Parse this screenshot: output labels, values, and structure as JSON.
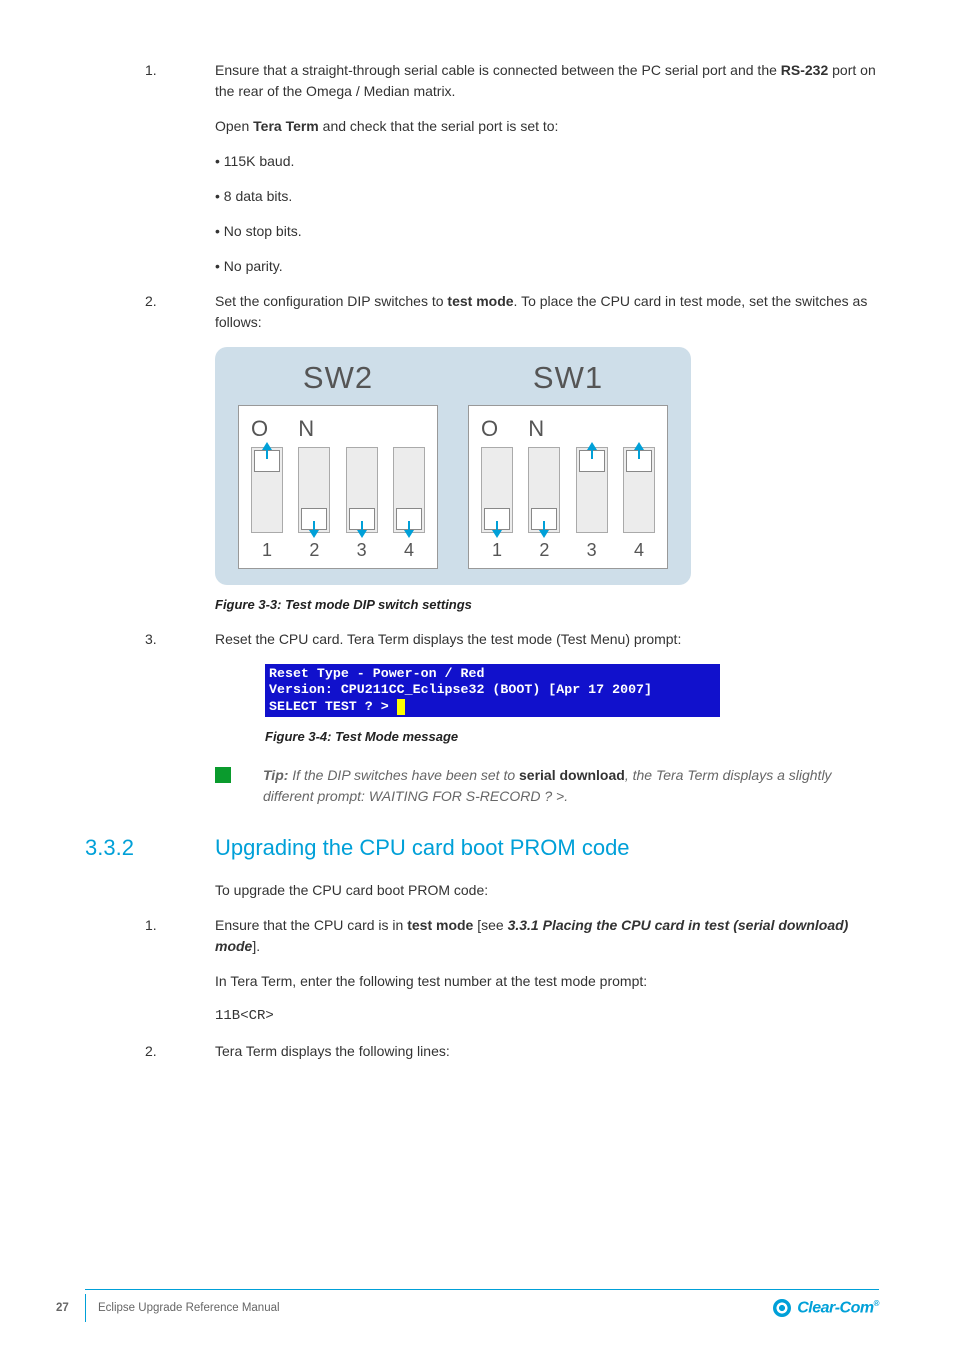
{
  "step1": {
    "num": "1.",
    "line1_prefix": "Ensure that a straight-through serial cable is connected between the PC serial port and the ",
    "line1_bold": "RS-232",
    "line1_suffix": " port on the rear of the Omega / Median matrix.",
    "line2_prefix": "Open ",
    "line2_bold": "Tera Term",
    "line2_suffix": " and check that the serial port is set to:"
  },
  "settings": {
    "a": "• 115K baud.",
    "b": "• 8 data bits.",
    "c": "• No stop bits.",
    "d": "• No parity."
  },
  "step2": {
    "num": "2.",
    "text_prefix": "Set the configuration DIP switches to ",
    "text_bold": "test mode",
    "text_suffix": ". To place the CPU card in test mode, set the switches as follows:"
  },
  "diagram": {
    "sw2": {
      "title": "SW2",
      "positions": [
        "up",
        "down",
        "down",
        "down"
      ]
    },
    "sw1": {
      "title": "SW1",
      "positions": [
        "down",
        "down",
        "up",
        "up"
      ]
    },
    "on_label": "O N",
    "nums": [
      "1",
      "2",
      "3",
      "4"
    ]
  },
  "caption1": "Figure 3-3: Test mode DIP switch settings",
  "step3": {
    "num": "3.",
    "text": "Reset the CPU card. Tera Term displays the test mode (Test Menu) prompt:"
  },
  "terminal": {
    "l1": "Reset Type - Power-on / Red",
    "l2": "Version: CPU211CC_Eclipse32 (BOOT) [Apr 17 2007]",
    "l3": "SELECT TEST ? > "
  },
  "caption2": "Figure 3-4: Test Mode message",
  "tip": {
    "label": "Tip:",
    "text_prefix": " If the DIP switches have been set to ",
    "text_bold": "serial download",
    "text_suffix": ", the Tera Term displays a slightly different prompt: WAITING FOR S-RECORD ? >."
  },
  "heading": {
    "num": "3.3.2",
    "title": "Upgrading the CPU card boot PROM code"
  },
  "below": {
    "p1": "To upgrade the CPU card boot PROM code:",
    "s1": {
      "num": "1.",
      "p_a": "Ensure that the CPU card is in ",
      "p_b": "test mode",
      "p_c": " [see ",
      "p_d": "3.3.1 Placing the CPU card in test (serial download) mode",
      "p_e": "].",
      "p2": "In Tera Term, enter the following test number at the test mode prompt:",
      "code": "11B<CR>"
    },
    "s2": {
      "num": "2.",
      "p": "Tera Term displays the following lines:"
    }
  },
  "footer": {
    "page": "27",
    "doc": "Eclipse Upgrade Reference Manual",
    "brand": "Clear-Com"
  }
}
